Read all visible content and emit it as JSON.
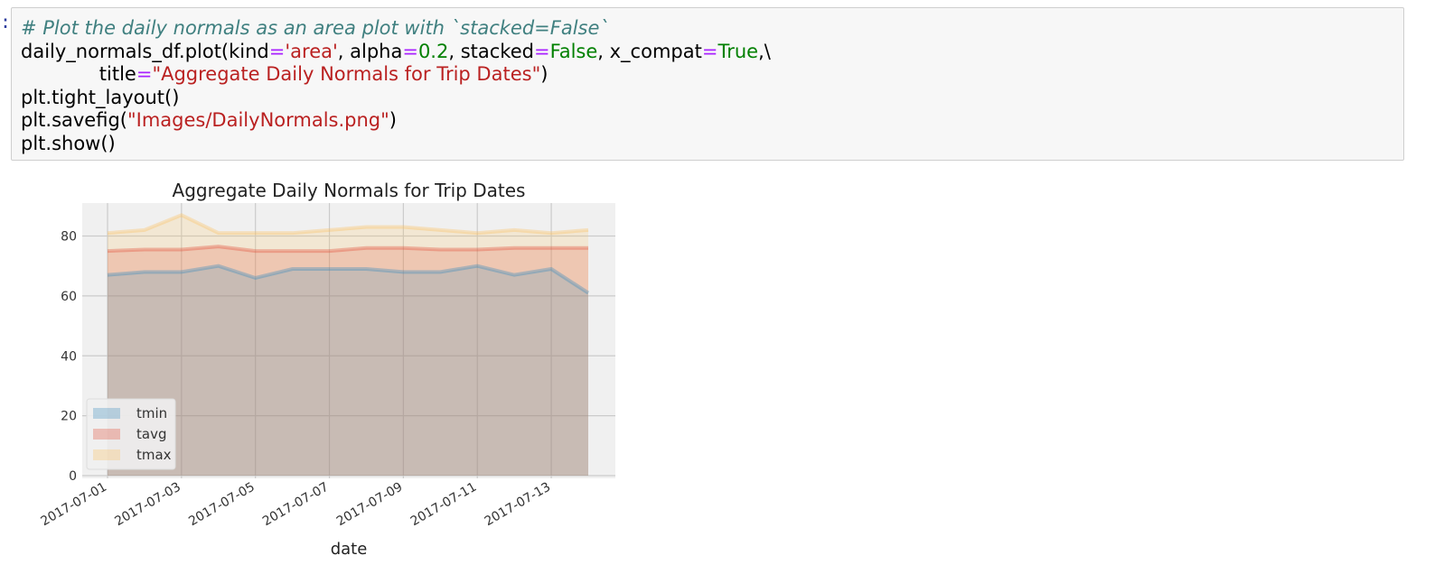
{
  "cell": {
    "prompt": ":",
    "lines": [
      [
        {
          "t": "c-comment",
          "v": "# Plot the daily normals as an area plot with `stacked=False`"
        }
      ],
      [
        {
          "t": "",
          "v": "daily_normals_df.plot(kind"
        },
        {
          "t": "c-op",
          "v": "="
        },
        {
          "t": "c-str",
          "v": "'area'"
        },
        {
          "t": "",
          "v": ", alpha"
        },
        {
          "t": "c-op",
          "v": "="
        },
        {
          "t": "c-num",
          "v": "0.2"
        },
        {
          "t": "",
          "v": ", stacked"
        },
        {
          "t": "c-op",
          "v": "="
        },
        {
          "t": "c-kw",
          "v": "False"
        },
        {
          "t": "",
          "v": ", x_compat"
        },
        {
          "t": "c-op",
          "v": "="
        },
        {
          "t": "c-kw",
          "v": "True"
        },
        {
          "t": "",
          "v": ",\\"
        }
      ],
      [
        {
          "t": "",
          "v": "             title"
        },
        {
          "t": "c-op",
          "v": "="
        },
        {
          "t": "c-str",
          "v": "\"Aggregate Daily Normals for Trip Dates\""
        },
        {
          "t": "",
          "v": ")"
        }
      ],
      [
        {
          "t": "",
          "v": "plt.tight_layout()"
        }
      ],
      [
        {
          "t": "",
          "v": "plt.savefig("
        },
        {
          "t": "c-str",
          "v": "\"Images/DailyNormals.png\""
        },
        {
          "t": "",
          "v": ")"
        }
      ],
      [
        {
          "t": "",
          "v": "plt.show()"
        }
      ]
    ]
  },
  "chart_data": {
    "type": "area",
    "title": "Aggregate Daily Normals for Trip Dates",
    "xlabel": "date",
    "ylabel": "",
    "x": [
      "2017-07-01",
      "2017-07-02",
      "2017-07-03",
      "2017-07-04",
      "2017-07-05",
      "2017-07-06",
      "2017-07-07",
      "2017-07-08",
      "2017-07-09",
      "2017-07-10",
      "2017-07-11",
      "2017-07-12",
      "2017-07-13",
      "2017-07-14"
    ],
    "xticks": [
      "2017-07-01",
      "2017-07-03",
      "2017-07-05",
      "2017-07-07",
      "2017-07-09",
      "2017-07-11",
      "2017-07-13"
    ],
    "yticks": [
      0,
      20,
      40,
      60,
      80
    ],
    "ylim": [
      0,
      91
    ],
    "grid": true,
    "legend": "lower-left",
    "stacked": false,
    "alpha": 0.2,
    "series": [
      {
        "name": "tmin",
        "color": "#348abd",
        "values": [
          67,
          68,
          68,
          70,
          66,
          69,
          69,
          69,
          68,
          68,
          70,
          67,
          69,
          61
        ]
      },
      {
        "name": "tavg",
        "color": "#e24a33",
        "values": [
          75,
          75.5,
          75.5,
          76.5,
          75,
          75,
          75,
          76,
          76,
          75.5,
          75.5,
          76,
          76,
          76
        ]
      },
      {
        "name": "tmax",
        "color": "#fbc15e",
        "values": [
          81,
          82,
          87,
          81,
          81,
          81,
          82,
          83,
          83,
          82,
          81,
          82,
          81,
          82
        ]
      }
    ]
  }
}
